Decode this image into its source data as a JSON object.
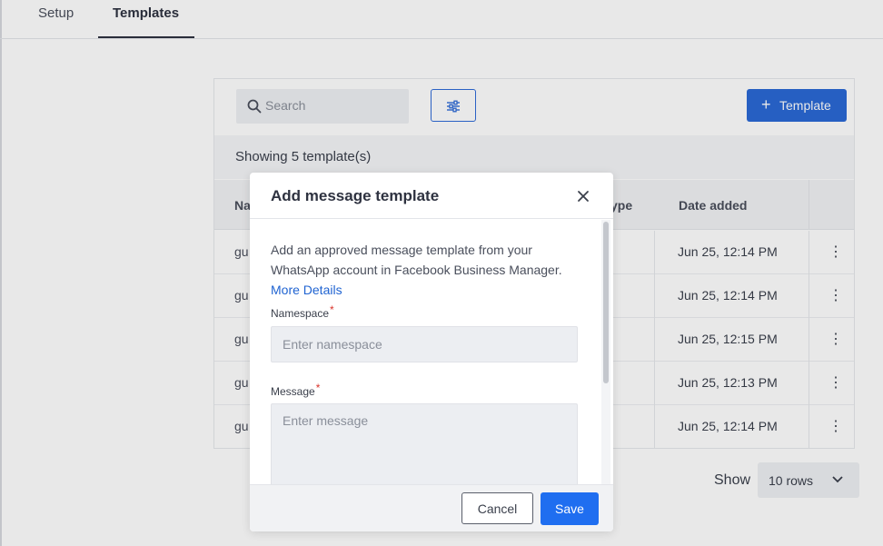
{
  "tabs": [
    {
      "label": "Setup",
      "active": false
    },
    {
      "label": "Templates",
      "active": true
    }
  ],
  "toolbar": {
    "search_placeholder": "Search",
    "add_template_label": "Template"
  },
  "list": {
    "showing_text": "Showing 5 template(s)",
    "columns": [
      "Na",
      "ype",
      "Date added"
    ],
    "rows": [
      {
        "name": "gu",
        "date": "Jun 25, 12:14 PM"
      },
      {
        "name": "gu",
        "date": "Jun 25, 12:14 PM"
      },
      {
        "name": "gu",
        "date": "Jun 25, 12:15 PM"
      },
      {
        "name": "gu",
        "date": "Jun 25, 12:13 PM"
      },
      {
        "name": "gu",
        "date": "Jun 25, 12:14 PM"
      }
    ]
  },
  "pagination": {
    "show_label": "Show",
    "rows_value": "10 rows"
  },
  "modal": {
    "title": "Add message template",
    "description": "Add an approved message template from your WhatsApp account in Facebook Business Manager.",
    "more_link": "More Details",
    "namespace_label": "Namespace",
    "namespace_placeholder": "Enter namespace",
    "message_label": "Message",
    "message_placeholder": "Enter message",
    "required_mark": "*",
    "cancel_label": "Cancel",
    "save_label": "Save"
  },
  "colors": {
    "primary": "#2a69d6",
    "save": "#1f6ef0",
    "link": "#1f63d1",
    "required": "#d9342b"
  }
}
